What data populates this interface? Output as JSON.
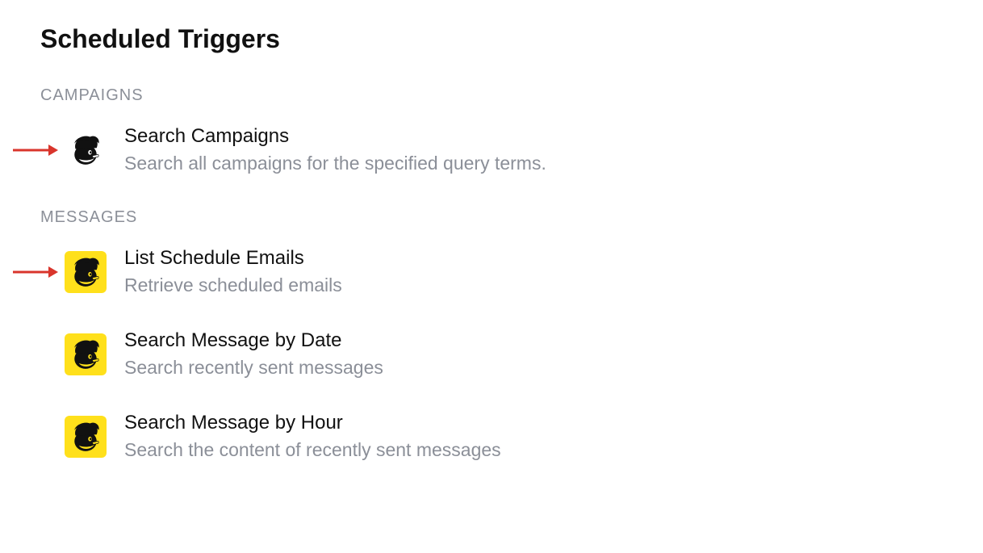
{
  "page": {
    "title": "Scheduled Triggers"
  },
  "sections": [
    {
      "label": "CAMPAIGNS",
      "items": [
        {
          "id": "search-campaigns",
          "title": "Search Campaigns",
          "desc": "Search all campaigns for the specified query terms.",
          "icon_variant": "white",
          "annotated": true
        }
      ]
    },
    {
      "label": "MESSAGES",
      "items": [
        {
          "id": "list-schedule-emails",
          "title": "List Schedule Emails",
          "desc": "Retrieve scheduled emails",
          "icon_variant": "yellow",
          "annotated": true
        },
        {
          "id": "search-message-by-date",
          "title": "Search Message by Date",
          "desc": "Search recently sent messages",
          "icon_variant": "yellow",
          "annotated": false
        },
        {
          "id": "search-message-by-hour",
          "title": "Search Message by Hour",
          "desc": "Search the content of recently sent messages",
          "icon_variant": "yellow",
          "annotated": false
        }
      ]
    }
  ],
  "colors": {
    "accent_yellow": "#ffe01b",
    "arrow_red": "#d9352c",
    "muted": "#8b8f98"
  },
  "icons": {
    "service": "mailchimp-icon"
  }
}
